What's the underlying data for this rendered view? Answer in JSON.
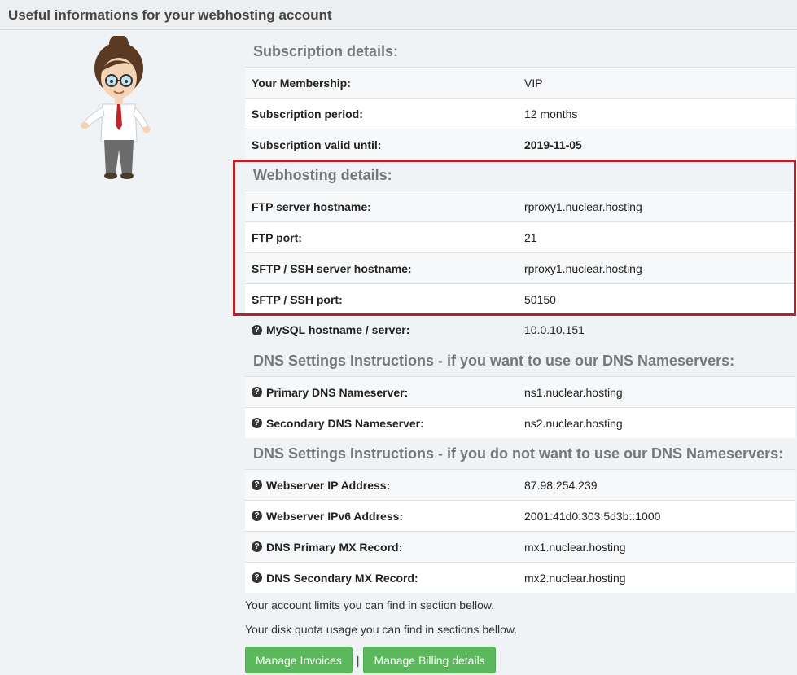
{
  "panel": {
    "title": "Useful informations for your webhosting account"
  },
  "subscription": {
    "heading": "Subscription details:",
    "rows": [
      {
        "label": "Your Membership:",
        "value": "VIP"
      },
      {
        "label": "Subscription period:",
        "value": "12 months"
      },
      {
        "label": "Subscription valid until:",
        "value": "2019-11-05"
      }
    ]
  },
  "webhosting": {
    "heading": "Webhosting details:",
    "rows": [
      {
        "label": "FTP server hostname:",
        "value": "rproxy1.nuclear.hosting"
      },
      {
        "label": "FTP port:",
        "value": "21"
      },
      {
        "label": "SFTP / SSH server hostname:",
        "value": "rproxy1.nuclear.hosting"
      },
      {
        "label": "SFTP / SSH port:",
        "value": "50150"
      }
    ],
    "mysql": {
      "label": "MySQL hostname / server:",
      "value": "10.0.10.151"
    }
  },
  "dns_use": {
    "heading": "DNS Settings Instructions - if you want to use our DNS Nameservers:",
    "rows": [
      {
        "label": "Primary DNS Nameserver:",
        "value": "ns1.nuclear.hosting"
      },
      {
        "label": "Secondary DNS Nameserver:",
        "value": "ns2.nuclear.hosting"
      }
    ]
  },
  "dns_nouse": {
    "heading": "DNS Settings Instructions - if you do not want to use our DNS Nameservers:",
    "rows": [
      {
        "label": "Webserver IP Address:",
        "value": "87.98.254.239"
      },
      {
        "label": "Webserver IPv6 Address:",
        "value": "2001:41d0:303:5d3b::1000"
      },
      {
        "label": "DNS Primary MX Record:",
        "value": "mx1.nuclear.hosting"
      },
      {
        "label": "DNS Secondary MX Record:",
        "value": "mx2.nuclear.hosting"
      }
    ]
  },
  "notes": {
    "limits": "Your account limits you can find in section bellow.",
    "quota": "Your disk quota usage you can find in sections bellow."
  },
  "buttons": {
    "invoices": "Manage Invoices",
    "separator": "|",
    "billing": "Manage Billing details"
  },
  "icons": {
    "help": "question-circle-icon"
  },
  "colors": {
    "accent_green": "#5cb85c",
    "highlight_red": "#b5232a"
  }
}
